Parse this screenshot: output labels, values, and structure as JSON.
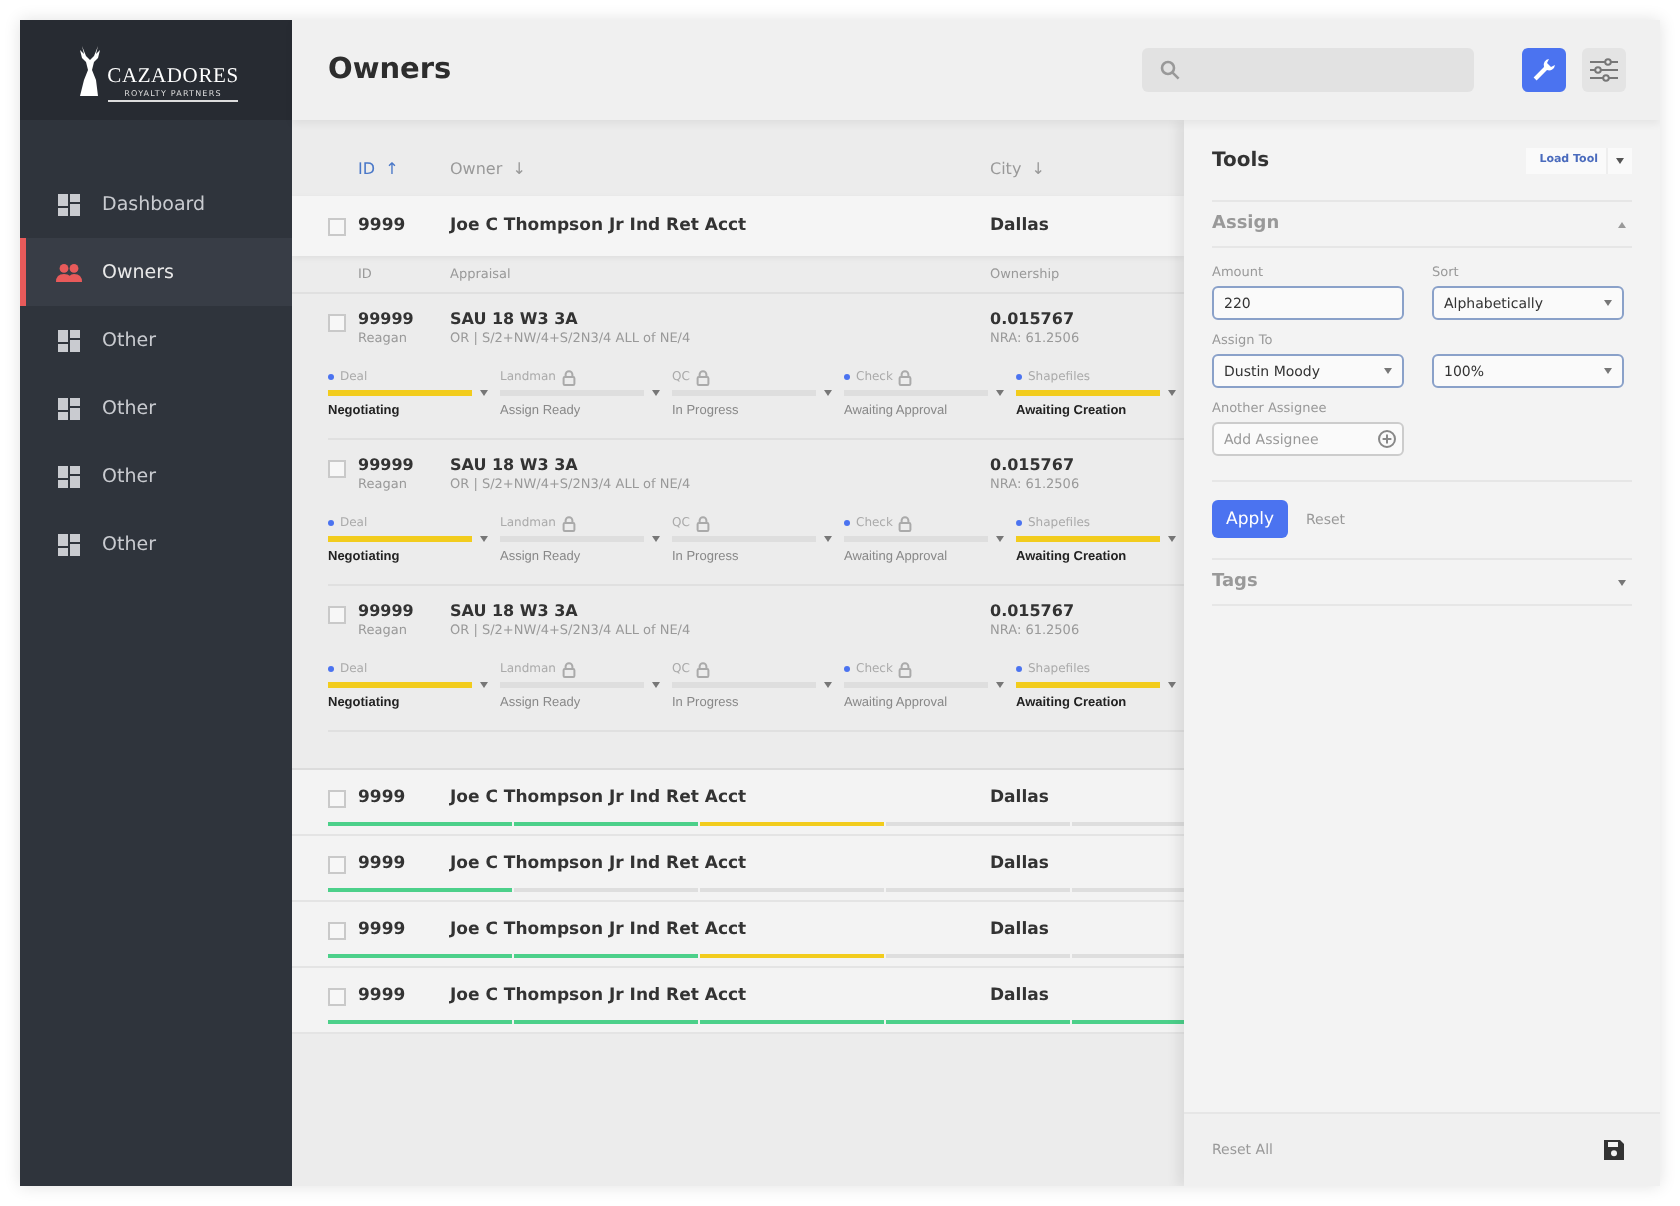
{
  "sidebar": {
    "logo": {
      "name": "CAZADORES",
      "tagline": "ROYALTY PARTNERS"
    },
    "items": [
      {
        "label": "Dashboard",
        "kind": "grid",
        "selected": false
      },
      {
        "label": "Owners",
        "kind": "people",
        "selected": true
      },
      {
        "label": "Other",
        "kind": "grid",
        "selected": false
      },
      {
        "label": "Other",
        "kind": "grid",
        "selected": false
      },
      {
        "label": "Other",
        "kind": "grid",
        "selected": false
      },
      {
        "label": "Other",
        "kind": "grid",
        "selected": false
      }
    ]
  },
  "header": {
    "title": "Owners",
    "tools": [
      {
        "kind": "wrench",
        "selected": true
      },
      {
        "kind": "sliders",
        "selected": false
      }
    ]
  },
  "table": {
    "columns": [
      {
        "label": "ID",
        "sort": "↑",
        "selected": true
      },
      {
        "label": "Owner",
        "sort": "↓",
        "selected": false
      },
      {
        "label": "City",
        "sort": "↓",
        "selected": false
      }
    ],
    "expanded_row": {
      "checked": false,
      "id": "9999",
      "owner": "Joe C Thompson Jr Ind Ret Acct",
      "city": "Dallas",
      "detail_columns": [
        "ID",
        "Appraisal",
        "Ownership"
      ],
      "details": [
        {
          "checked": false,
          "id": "99999",
          "sub": "Reagan",
          "appraisal": "SAU 18 W3 3A",
          "legal": "OR | S/2+NW/4+S/2N3/4 ALL of NE/4",
          "ownership": "0.015767",
          "nra": "NRA: 61.2506",
          "stages": [
            {
              "label": "Deal",
              "dot": true,
              "locked": false,
              "active": true,
              "status": "Negotiating"
            },
            {
              "label": "Landman",
              "dot": false,
              "locked": true,
              "active": false,
              "status": "Assign Ready"
            },
            {
              "label": "QC",
              "dot": false,
              "locked": true,
              "active": false,
              "status": "In Progress"
            },
            {
              "label": "Check",
              "dot": true,
              "locked": true,
              "active": false,
              "status": "Awaiting Approval"
            },
            {
              "label": "Shapefiles",
              "dot": true,
              "locked": false,
              "active": true,
              "status": "Awaiting Creation"
            }
          ]
        },
        {
          "checked": false,
          "id": "99999",
          "sub": "Reagan",
          "appraisal": "SAU 18 W3 3A",
          "legal": "OR | S/2+NW/4+S/2N3/4 ALL of NE/4",
          "ownership": "0.015767",
          "nra": "NRA: 61.2506",
          "stages": [
            {
              "label": "Deal",
              "dot": true,
              "locked": false,
              "active": true,
              "status": "Negotiating"
            },
            {
              "label": "Landman",
              "dot": false,
              "locked": true,
              "active": false,
              "status": "Assign Ready"
            },
            {
              "label": "QC",
              "dot": false,
              "locked": true,
              "active": false,
              "status": "In Progress"
            },
            {
              "label": "Check",
              "dot": true,
              "locked": true,
              "active": false,
              "status": "Awaiting Approval"
            },
            {
              "label": "Shapefiles",
              "dot": true,
              "locked": false,
              "active": true,
              "status": "Awaiting Creation"
            }
          ]
        },
        {
          "checked": false,
          "id": "99999",
          "sub": "Reagan",
          "appraisal": "SAU 18 W3 3A",
          "legal": "OR | S/2+NW/4+S/2N3/4 ALL of NE/4",
          "ownership": "0.015767",
          "nra": "NRA: 61.2506",
          "stages": [
            {
              "label": "Deal",
              "dot": true,
              "locked": false,
              "active": true,
              "status": "Negotiating"
            },
            {
              "label": "Landman",
              "dot": false,
              "locked": true,
              "active": false,
              "status": "Assign Ready"
            },
            {
              "label": "QC",
              "dot": false,
              "locked": true,
              "active": false,
              "status": "In Progress"
            },
            {
              "label": "Check",
              "dot": true,
              "locked": true,
              "active": false,
              "status": "Awaiting Approval"
            },
            {
              "label": "Shapefiles",
              "dot": true,
              "locked": false,
              "active": true,
              "status": "Awaiting Creation"
            }
          ]
        }
      ]
    },
    "rows": [
      {
        "checked": false,
        "id": "9999",
        "owner": "Joe C Thompson Jr Ind Ret Acct",
        "city": "Dallas",
        "progress": [
          {
            "kind": "done"
          },
          {
            "kind": "done"
          },
          {
            "kind": "current"
          },
          {
            "kind": "pending"
          },
          {
            "kind": "pending"
          }
        ]
      },
      {
        "checked": false,
        "id": "9999",
        "owner": "Joe C Thompson Jr Ind Ret Acct",
        "city": "Dallas",
        "progress": [
          {
            "kind": "done"
          },
          {
            "kind": "pending"
          },
          {
            "kind": "pending"
          },
          {
            "kind": "pending"
          },
          {
            "kind": "pending"
          }
        ]
      },
      {
        "checked": false,
        "id": "9999",
        "owner": "Joe C Thompson Jr Ind Ret Acct",
        "city": "Dallas",
        "progress": [
          {
            "kind": "done"
          },
          {
            "kind": "done"
          },
          {
            "kind": "current"
          },
          {
            "kind": "pending"
          },
          {
            "kind": "pending"
          }
        ]
      },
      {
        "checked": false,
        "id": "9999",
        "owner": "Joe C Thompson Jr Ind Ret Acct",
        "city": "Dallas",
        "progress": [
          {
            "kind": "done"
          },
          {
            "kind": "done"
          },
          {
            "kind": "done"
          },
          {
            "kind": "done"
          },
          {
            "kind": "done"
          }
        ]
      }
    ]
  },
  "panel": {
    "title": "Tools",
    "load_button": "Load Tool",
    "sections": [
      {
        "kind": "assign",
        "title": "Assign",
        "expanded": true
      },
      {
        "kind": "tags",
        "title": "Tags",
        "expanded": false
      }
    ],
    "assign": {
      "amount": {
        "label": "Amount",
        "value": "220"
      },
      "sort": {
        "label": "Sort",
        "value": "Alphabetically"
      },
      "assign_to": {
        "label": "Assign To",
        "value": "Dustin Moody"
      },
      "share": {
        "value": "100%"
      },
      "another": {
        "label": "Another Assignee",
        "placeholder": "Add Assignee"
      },
      "apply": "Apply",
      "reset": "Reset"
    },
    "footer": {
      "reset_all": "Reset All"
    }
  }
}
